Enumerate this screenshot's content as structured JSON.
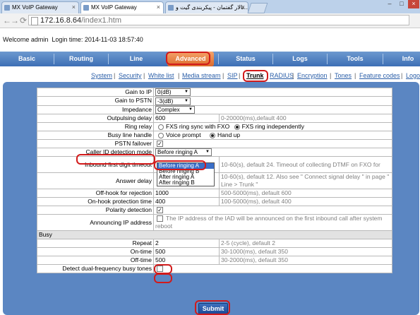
{
  "browser": {
    "tabs": [
      {
        "title": "MX VoIP Gateway"
      },
      {
        "title": "MX VoIP Gateway"
      },
      {
        "title": "تالار گفتمان - پیکربندی گیت و..."
      }
    ],
    "url_host": "172.16.8.64",
    "url_path": "/index1.htm"
  },
  "welcome": {
    "text": "Welcome admin",
    "login_time": "Login time: 2014-11-03 18:57:40"
  },
  "main_nav": [
    "Basic",
    "Routing",
    "Line",
    "Advanced",
    "Status",
    "Logs",
    "Tools",
    "Info"
  ],
  "main_nav_active": "Advanced",
  "sub_nav": [
    "System",
    "Security",
    "White list",
    "Media stream",
    "SIP",
    "Trunk",
    "RADIUS",
    "Encryption",
    "Tones",
    "Feature codes",
    "Logo"
  ],
  "sub_nav_active": "Trunk",
  "rows": {
    "gain_ip": {
      "label": "Gain to IP",
      "value": "0(dB)"
    },
    "gain_pstn": {
      "label": "Gain to PSTN",
      "value": "-3(dB)"
    },
    "impedance": {
      "label": "Impedance",
      "value": "Complex"
    },
    "outpulsing": {
      "label": "Outpulsing delay",
      "value": "600",
      "hint": "0-20000(ms),default 400"
    },
    "ring_relay": {
      "label": "Ring relay",
      "opt1": "FXS ring sync with FXO",
      "opt2": "FXS ring independently"
    },
    "busy_line": {
      "label": "Busy line handle",
      "opt1": "Voice prompt",
      "opt2": "Hand up"
    },
    "pstn_failover": {
      "label": "PSTN failover"
    },
    "caller_id": {
      "label": "Caller ID detection mode",
      "value": "Before ringing A"
    },
    "inbound_digit": {
      "label": "Inbound first digit timeout",
      "hint": "10-60(s), default 24. Timeout of collecting DTMF on FXO for"
    },
    "answer_delay": {
      "label": "Answer delay",
      "hint": "10-60(s), default 12. Also see \" Connect signal delay \" in page \" Line > Trunk \""
    },
    "offhook": {
      "label": "Off-hook for rejection",
      "value": "1000",
      "hint": "500-5000(ms), default 600"
    },
    "onhook": {
      "label": "On-hook protection time",
      "value": "400",
      "hint": "100-5000(ms), default 400"
    },
    "polarity": {
      "label": "Polarity detection"
    },
    "announcing": {
      "label": "Announcing IP address",
      "hint": "The IP address of the IAD will be announced on the first inbound call after system reboot"
    },
    "busy_section": "Busy",
    "repeat": {
      "label": "Repeat",
      "value": "2",
      "hint": "2-5 (cycle), default 2"
    },
    "ontime": {
      "label": "On-time",
      "value": "500",
      "hint": "30-1000(ms), default 350"
    },
    "offtime": {
      "label": "Off-time",
      "value": "500",
      "hint": "30-2000(ms), default 350"
    },
    "dual_freq": {
      "label": "Detect dual-frequency busy tones"
    }
  },
  "caller_id_options": [
    "Before ringing A",
    "Before ringing B",
    "After ringing A",
    "After ringing B"
  ],
  "submit_label": "Submit",
  "colors": {
    "nav_blue": "#3d6fb5",
    "active_orange": "#dc6a2c",
    "panel_blue": "#5b86c2",
    "highlight_red": "#d21a1a"
  }
}
